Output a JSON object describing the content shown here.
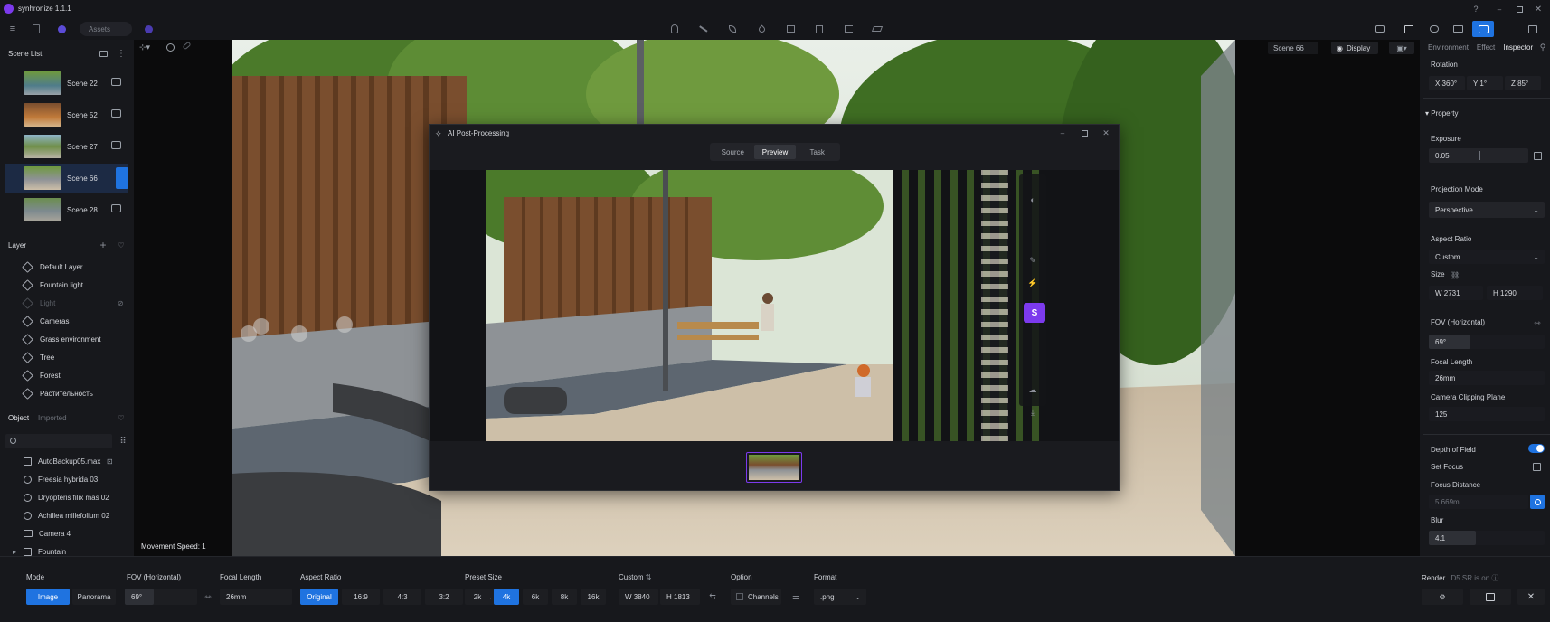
{
  "app": {
    "title": "synhronize 1.1.1",
    "assets_label": "Assets"
  },
  "scene_list": {
    "title": "Scene List",
    "items": [
      {
        "label": "Scene 22",
        "selected": false
      },
      {
        "label": "Scene 52",
        "selected": false
      },
      {
        "label": "Scene 27",
        "selected": false
      },
      {
        "label": "Scene 66",
        "selected": true
      },
      {
        "label": "Scene 28",
        "selected": false
      }
    ]
  },
  "layer": {
    "title": "Layer",
    "items": [
      {
        "label": "Default Layer",
        "dim": false
      },
      {
        "label": "Fountain light",
        "dim": false
      },
      {
        "label": "Light",
        "dim": true
      },
      {
        "label": "Cameras",
        "dim": false
      },
      {
        "label": "Grass environment",
        "dim": false
      },
      {
        "label": "Tree",
        "dim": false
      },
      {
        "label": "Forest",
        "dim": false
      },
      {
        "label": "Растительность",
        "dim": false
      }
    ]
  },
  "objects": {
    "tab_object": "Object",
    "tab_imported": "Imported",
    "search_placeholder": "",
    "items": [
      {
        "label": "AutoBackup05.max"
      },
      {
        "label": "Freesia hybrida 03"
      },
      {
        "label": "Dryopteris filix mas 02"
      },
      {
        "label": "Achillea millefolium 02"
      },
      {
        "label": "Camera 4"
      },
      {
        "label": "Fountain"
      }
    ]
  },
  "viewport": {
    "scene_badge": "Scene 66",
    "display_label": "Display",
    "movement_speed": "Movement Speed: 1"
  },
  "dialog": {
    "title": "AI Post-Processing",
    "tabs": [
      {
        "label": "Source",
        "active": false
      },
      {
        "label": "Preview",
        "active": true
      },
      {
        "label": "Task",
        "active": false
      }
    ]
  },
  "inspector": {
    "tabs": [
      {
        "label": "Environment",
        "active": false
      },
      {
        "label": "Effect",
        "active": false
      },
      {
        "label": "Inspector",
        "active": true
      }
    ],
    "rotation_label": "Rotation",
    "rotation": {
      "x": "X  360°",
      "y": "Y  1°",
      "z": "Z  85°"
    },
    "property_label": "Property",
    "exposure_label": "Exposure",
    "exposure_value": "0.05",
    "projection_mode_label": "Projection Mode",
    "projection_mode_value": "Perspective",
    "aspect_ratio_label": "Aspect Ratio",
    "aspect_ratio_value": "Custom",
    "size_label": "Size",
    "size_w": "W  2731",
    "size_h": "H  1290",
    "fov_label": "FOV (Horizontal)",
    "fov_value": "69°",
    "focal_length_label": "Focal Length",
    "focal_length_value": "26mm",
    "clipping_label": "Camera Clipping Plane",
    "clipping_value": "125",
    "dof_label": "Depth of Field",
    "dof_on": true,
    "set_focus_label": "Set Focus",
    "focus_distance_label": "Focus Distance",
    "focus_distance_value": "5.669m",
    "blur_label": "Blur",
    "blur_value": "4.1"
  },
  "bottom": {
    "mode_label": "Mode",
    "mode_image": "Image",
    "mode_panorama": "Panorama",
    "fov_label": "FOV (Horizontal)",
    "fov_value": "69°",
    "focal_label": "Focal Length",
    "focal_value": "26mm",
    "aspect_label": "Aspect Ratio",
    "aspect_options": [
      {
        "label": "Original",
        "active": true
      },
      {
        "label": "16:9",
        "active": false
      },
      {
        "label": "4:3",
        "active": false
      },
      {
        "label": "3:2",
        "active": false
      },
      {
        "label": "1:1",
        "active": false
      }
    ],
    "preset_label": "Preset Size",
    "preset_options": [
      {
        "label": "2k",
        "active": false
      },
      {
        "label": "4k",
        "active": true
      },
      {
        "label": "6k",
        "active": false
      },
      {
        "label": "8k",
        "active": false
      },
      {
        "label": "16k",
        "active": false
      }
    ],
    "custom_label": "Custom",
    "custom_w": "W  3840",
    "custom_h": "H  1813",
    "option_label": "Option",
    "channels_label": "Channels",
    "format_label": "Format",
    "format_value": ".png",
    "render_label": "Render",
    "render_note": "D5 SR is on"
  },
  "colors": {
    "accent": "#1f73e0",
    "purple": "#7c3aed",
    "panel": "#17181c"
  }
}
